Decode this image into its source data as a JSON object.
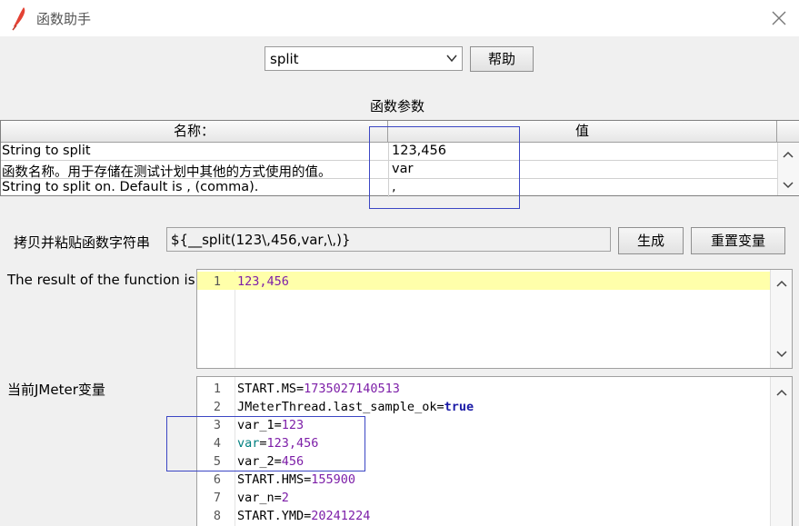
{
  "window": {
    "title": "函数助手"
  },
  "function_select": {
    "value": "split"
  },
  "buttons": {
    "help": "帮助",
    "generate": "生成",
    "reset": "重置变量"
  },
  "params": {
    "section_label": "函数参数",
    "header_name": "名称：",
    "header_value": "值",
    "rows": [
      {
        "name": "String to split",
        "value": "123,456"
      },
      {
        "name": "函数名称。用于存储在测试计划中其他的方式使用的值。",
        "value": "var"
      },
      {
        "name": "String to split on. Default is , (comma).",
        "value": ","
      }
    ]
  },
  "function_string": {
    "label": "拷贝并粘贴函数字符串",
    "value": "${__split(123\\,456,var,\\,)}"
  },
  "result": {
    "label": "The result of the function is",
    "lines": [
      {
        "num": "1",
        "text": "123,456"
      }
    ]
  },
  "variables": {
    "label": "当前JMeter变量",
    "lines": [
      {
        "num": "1",
        "key": "START.MS",
        "eq": "=",
        "val": "1735027140513"
      },
      {
        "num": "2",
        "key": "JMeterThread.last_sample_ok",
        "eq": "=",
        "val": "true"
      },
      {
        "num": "3",
        "key": "var_1",
        "eq": "=",
        "val": "123"
      },
      {
        "num": "4",
        "key": "var",
        "eq": "=",
        "val": "123,456"
      },
      {
        "num": "5",
        "key": "var_2",
        "eq": "=",
        "val": "456"
      },
      {
        "num": "6",
        "key": "START.HMS",
        "eq": "=",
        "val": "155900"
      },
      {
        "num": "7",
        "key": "var_n",
        "eq": "=",
        "val": "2"
      },
      {
        "num": "8",
        "key": "START.YMD",
        "eq": "=",
        "val": "20241224"
      }
    ]
  },
  "colors": {
    "highlight_box": "#3b46c4",
    "current_line": "#ffffaa",
    "value_purple": "#7d1fa8",
    "keyword_blue": "#1a1aa6"
  },
  "icons": {
    "app": "feather-icon",
    "close": "close-icon",
    "dropdown": "chevron-down-icon"
  }
}
